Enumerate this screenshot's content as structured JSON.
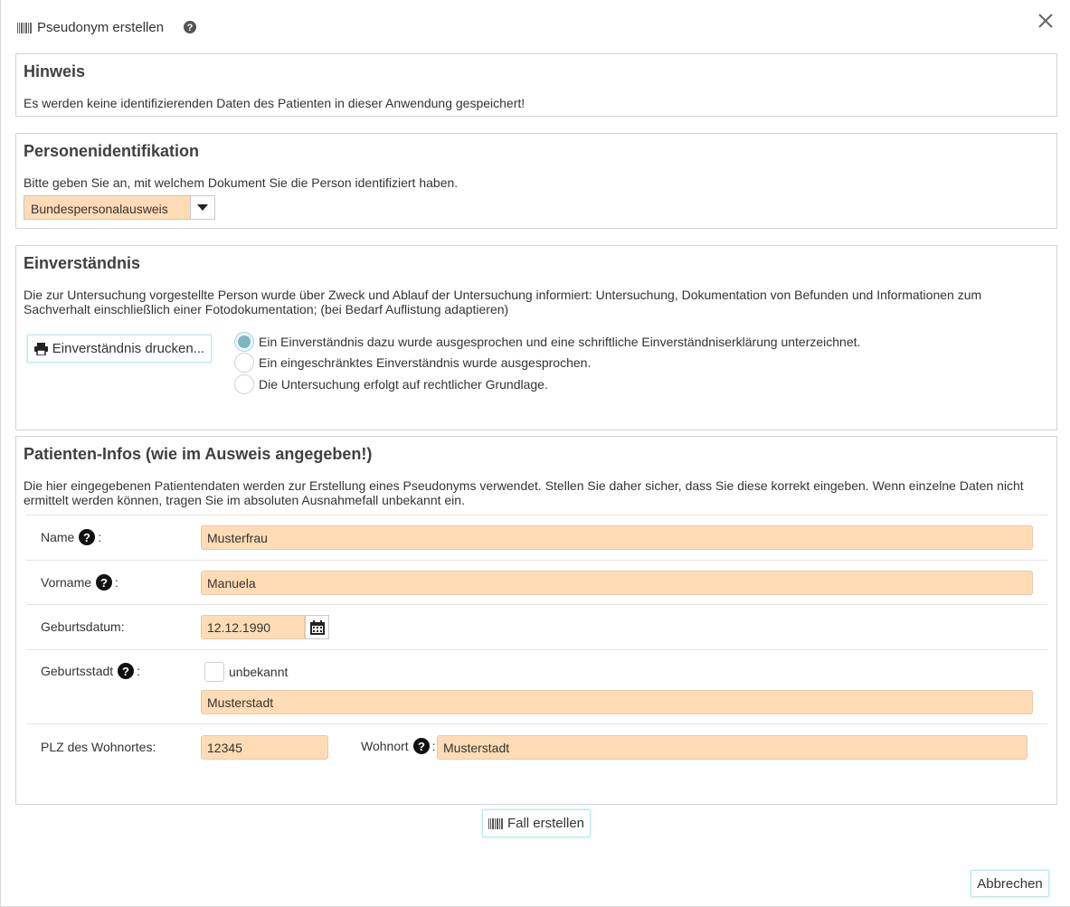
{
  "dialog": {
    "title": "Pseudonym erstellen",
    "cancel_label": "Abbrechen",
    "create_label": "Fall erstellen"
  },
  "hinweis": {
    "heading": "Hinweis",
    "text": "Es werden keine identifizierenden Daten des Patienten in dieser Anwendung gespeichert!"
  },
  "identifikation": {
    "heading": "Personenidentifikation",
    "text": "Bitte geben Sie an, mit welchem Dokument Sie die Person identifiziert haben.",
    "selected": "Bundespersonalausweis"
  },
  "einverstaendnis": {
    "heading": "Einverständnis",
    "text_line1": "Die zur Untersuchung vorgestellte Person wurde über Zweck und Ablauf der Untersuchung informiert: Untersuchung, Dokumentation von Befunden und Informationen zum",
    "text_line2": "Sachverhalt einschließlich einer Fotodokumentation; (bei Bedarf Auflistung adaptieren)",
    "print_label": "Einverständnis drucken...",
    "options": [
      "Ein Einverständnis dazu wurde ausgesprochen und eine schriftliche Einverständniserklärung unterzeichnet.",
      "Ein eingeschränktes Einverständnis wurde ausgesprochen.",
      "Die Untersuchung erfolgt auf rechtlicher Grundlage."
    ],
    "selected_index": 0
  },
  "patient": {
    "heading": "Patienten-Infos (wie im Ausweis angegeben!)",
    "text_line1": "Die hier eingegebenen Patientendaten werden zur Erstellung eines Pseudonyms verwendet. Stellen Sie daher sicher, dass Sie diese korrekt eingeben. Wenn einzelne Daten nicht",
    "text_line2": "ermittelt werden können, tragen Sie im absoluten Ausnahmefall unbekannt ein.",
    "name_label": "Name",
    "name_value": "Musterfrau",
    "vorname_label": "Vorname",
    "vorname_value": "Manuela",
    "geburtsdatum_label": "Geburtsdatum:",
    "geburtsdatum_value": "12.12.1990",
    "geburtsstadt_label": "Geburtsstadt",
    "unbekannt_label": "unbekannt",
    "geburtsstadt_value": "Musterstadt",
    "plz_label": "PLZ des Wohnortes:",
    "plz_value": "12345",
    "wohnort_label": "Wohnort",
    "wohnort_value": "Musterstadt",
    "colon": ":"
  }
}
